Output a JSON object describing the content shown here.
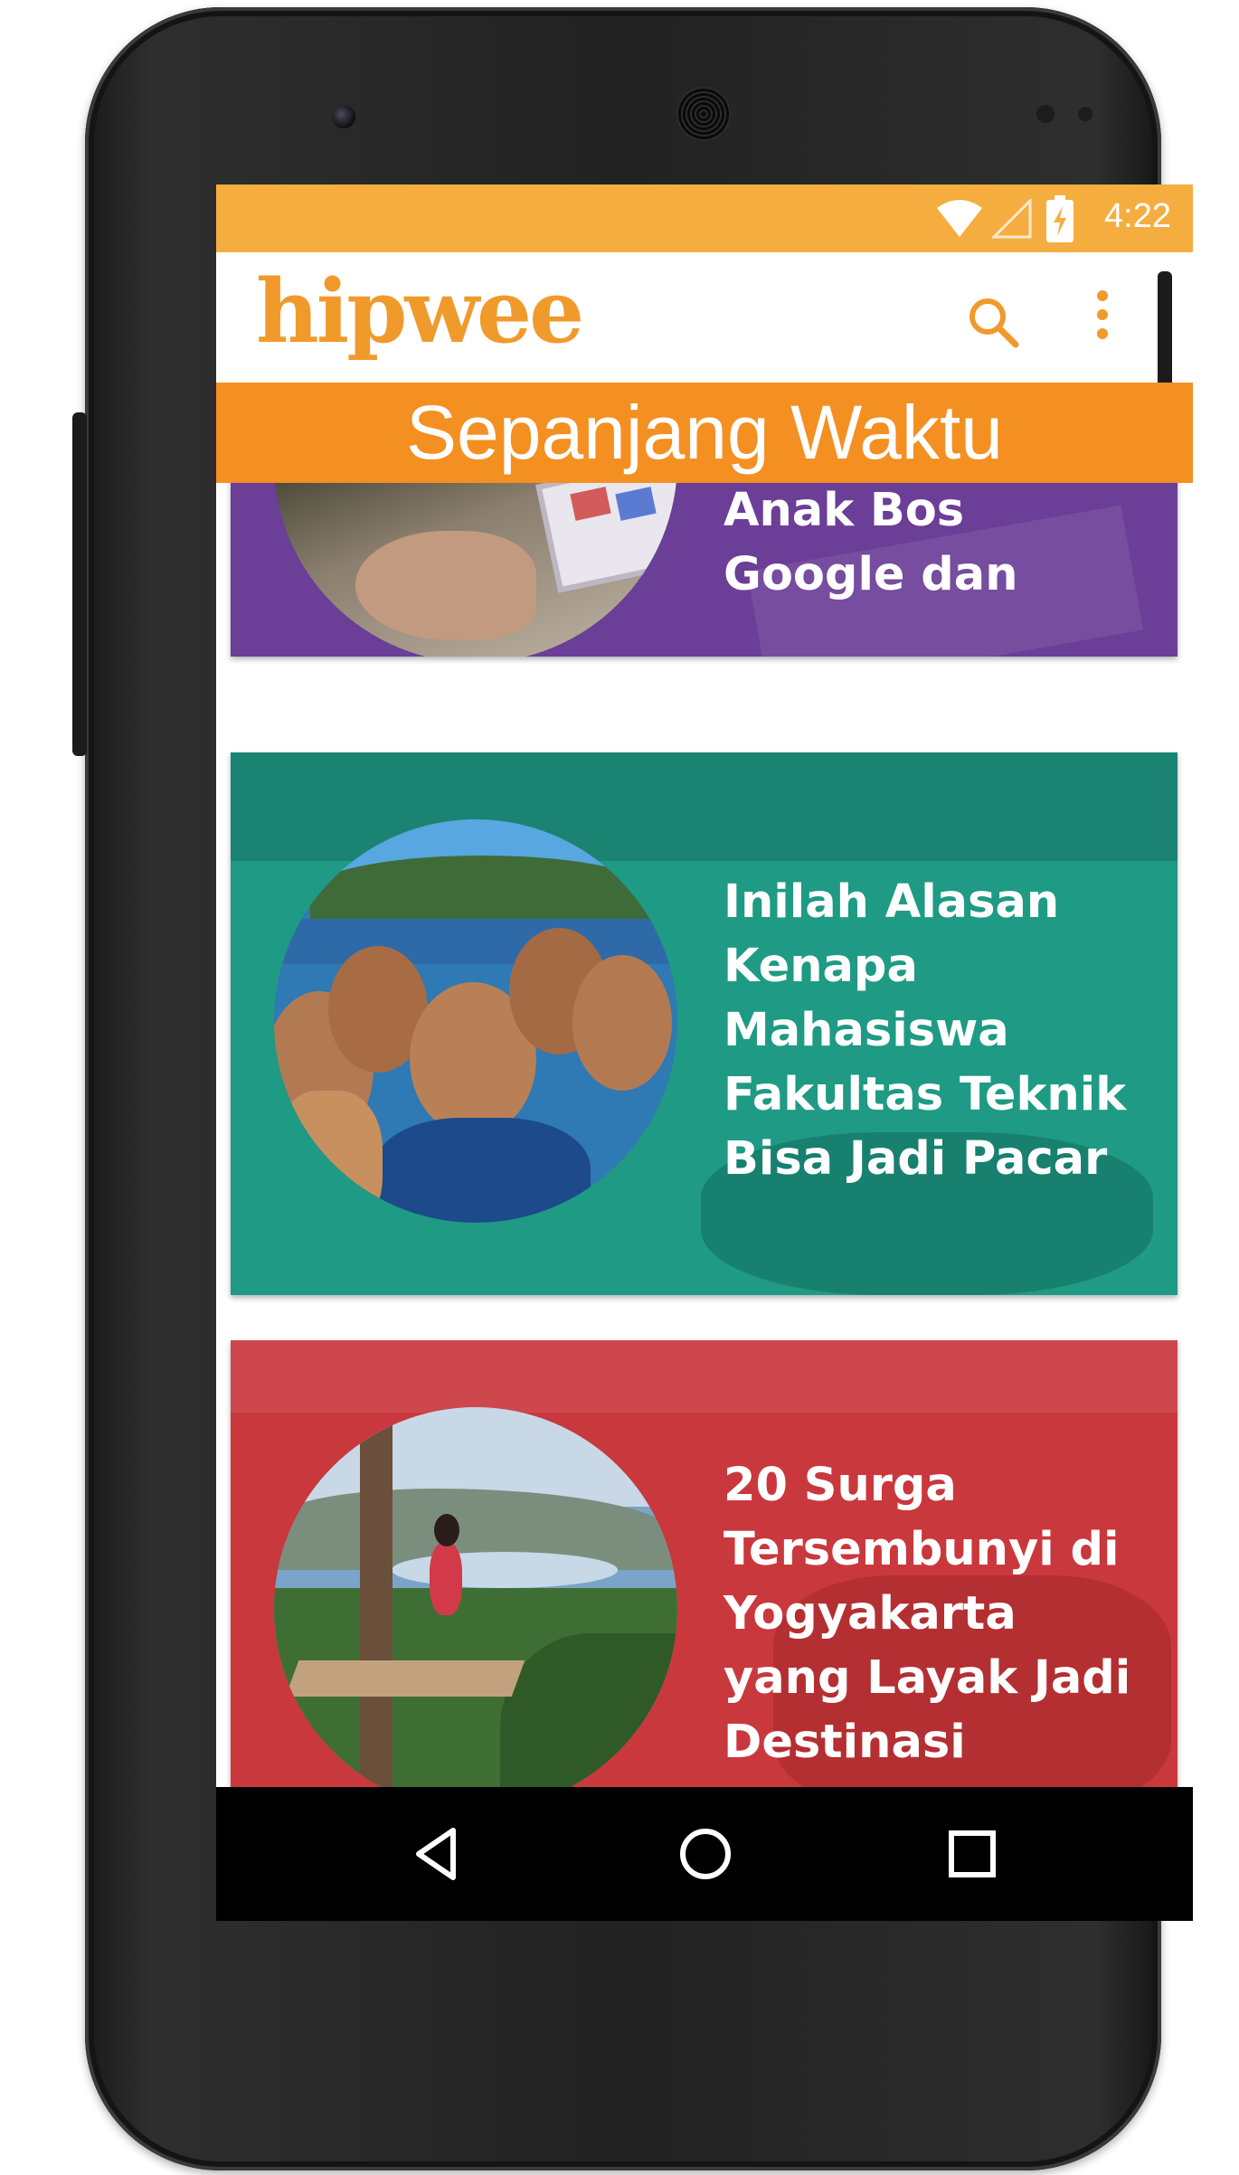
{
  "status_bar": {
    "time": "4:22",
    "icons": [
      "wifi-icon",
      "signal-icon",
      "battery-charging-icon"
    ],
    "color": "#f6ad3f"
  },
  "app_bar": {
    "logo_text": "hipwee",
    "actions": [
      "search-icon",
      "overflow-menu-icon"
    ]
  },
  "section": {
    "title": "Sepanjang Waktu",
    "color": "#f48f22"
  },
  "articles": [
    {
      "title": "Anak Bos Google dan",
      "color": "#6b3e97"
    },
    {
      "title": "Inilah Alasan Kenapa Mahasiswa Fakultas Teknik Bisa Jadi Pacar",
      "color": "#1f9a84"
    },
    {
      "title": "20 Surga Tersembunyi di Yogyakarta yang Layak Jadi Destinasi",
      "color": "#c9383d"
    }
  ],
  "nav_bar": {
    "buttons": [
      "back-icon",
      "home-icon",
      "recents-icon"
    ]
  }
}
